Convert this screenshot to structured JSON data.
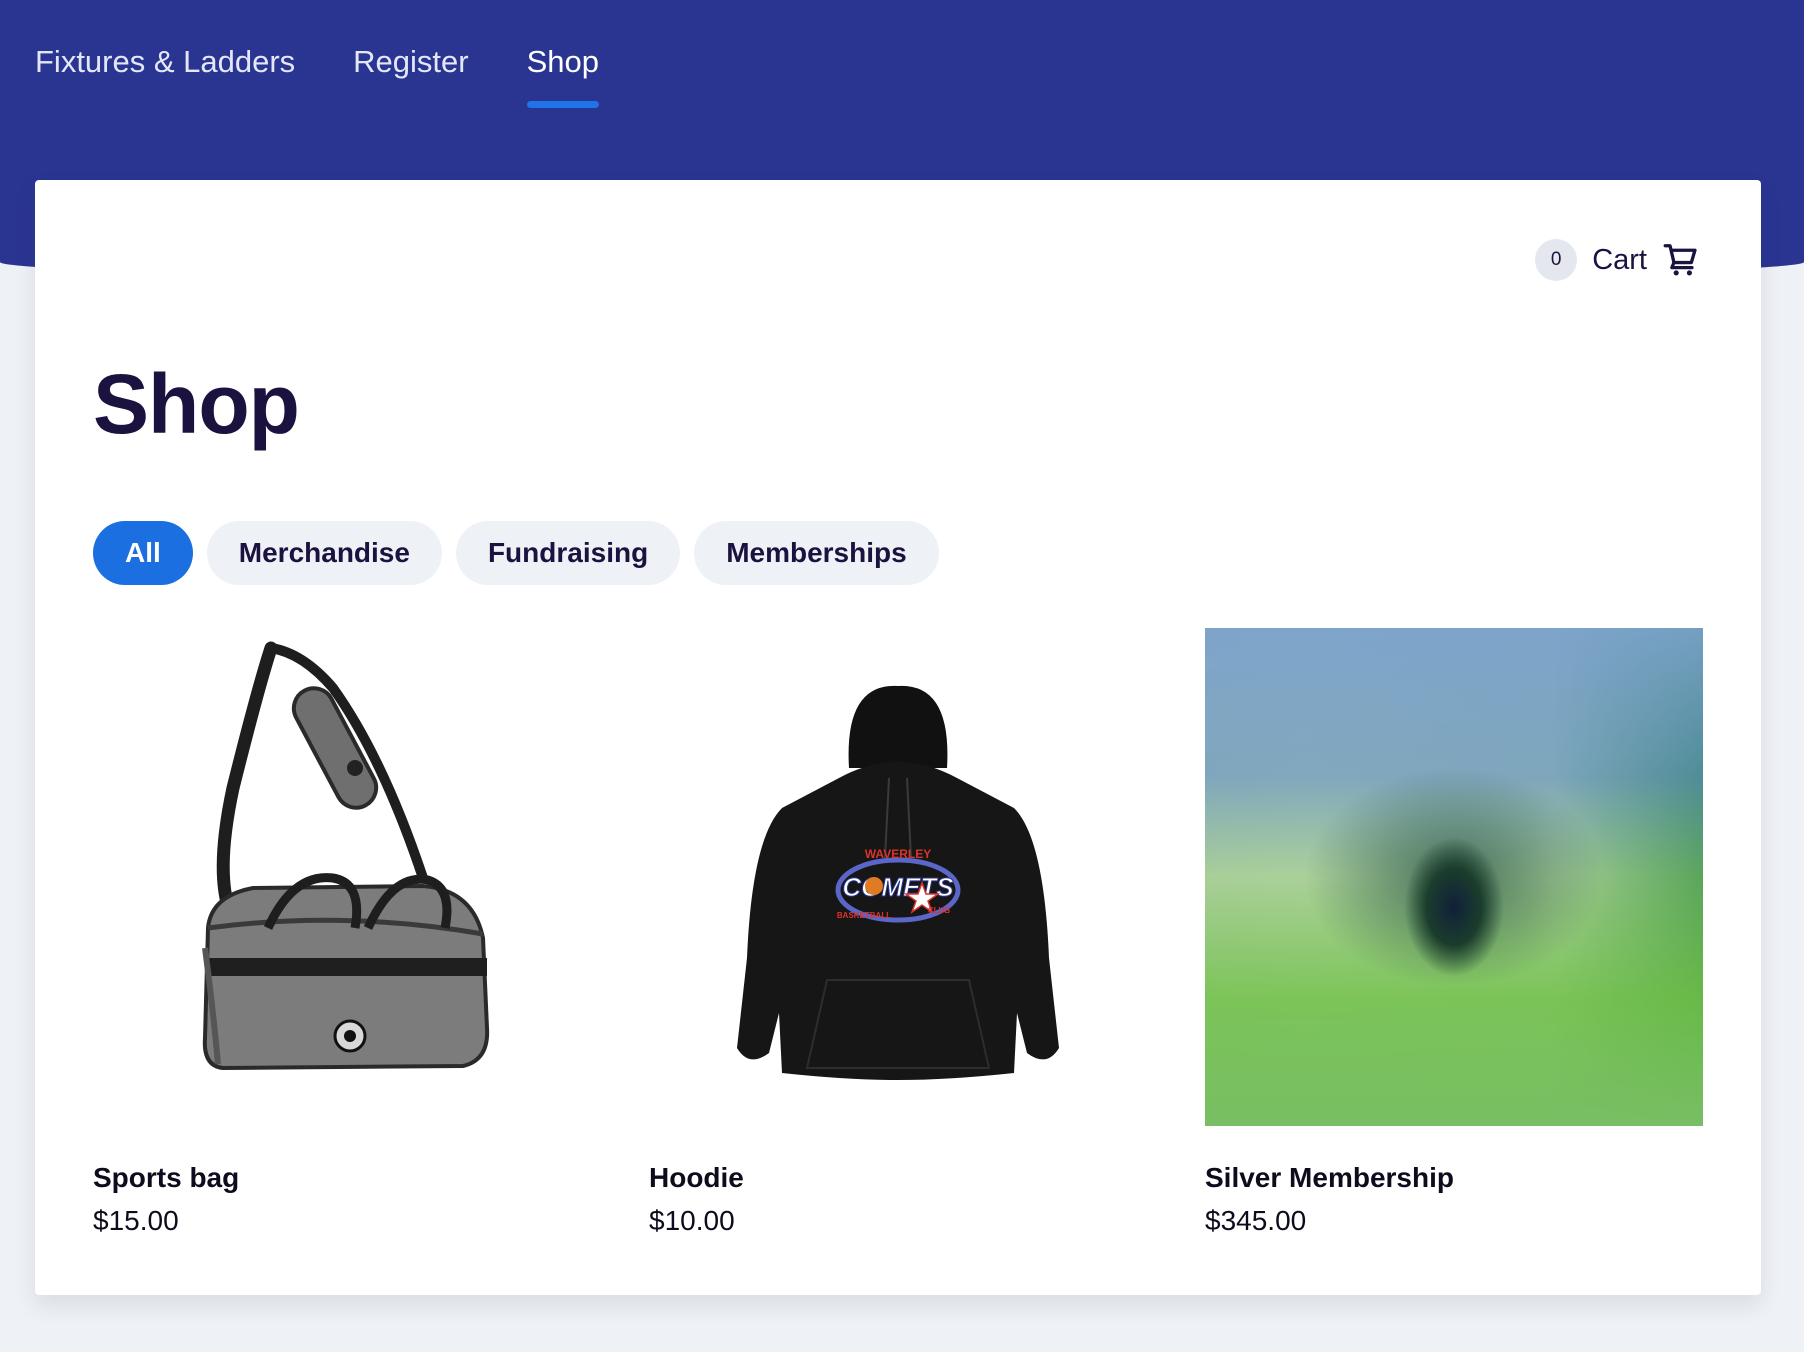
{
  "nav": {
    "items": [
      {
        "label": "Fixtures & Ladders",
        "active": false
      },
      {
        "label": "Register",
        "active": false
      },
      {
        "label": "Shop",
        "active": true
      }
    ]
  },
  "cart": {
    "count": "0",
    "label": "Cart",
    "icon": "shopping-cart-icon"
  },
  "page": {
    "title": "Shop"
  },
  "filters": [
    {
      "label": "All",
      "active": true
    },
    {
      "label": "Merchandise",
      "active": false
    },
    {
      "label": "Fundraising",
      "active": false
    },
    {
      "label": "Memberships",
      "active": false
    }
  ],
  "products": [
    {
      "name": "Sports bag",
      "price": "$15.00",
      "image": "sports-bag-image"
    },
    {
      "name": "Hoodie",
      "price": "$10.00",
      "image": "hoodie-image",
      "print": {
        "top": "WAVERLEY",
        "main": "COMETS",
        "bottom_left": "BASKETBALL",
        "bottom_right": "CLUB"
      }
    },
    {
      "name": "Silver Membership",
      "price": "$345.00",
      "image": "abstract-gradient-image"
    }
  ],
  "colors": {
    "header_bg": "#2a3592",
    "accent": "#1b6fe0",
    "text": "#1b1240"
  }
}
